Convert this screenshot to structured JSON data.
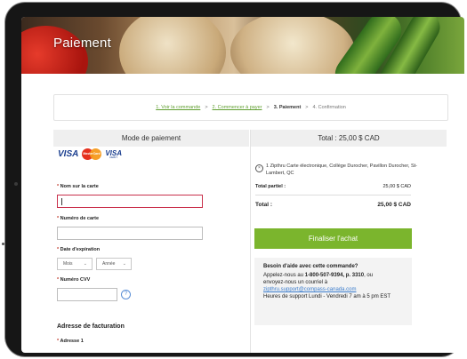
{
  "header": {
    "title": "Paiement"
  },
  "breadcrumb": {
    "step1": "1. Voir la commande",
    "step2": "2. Commencer à payer",
    "step3": "3. Paiement",
    "step4": "4. Confirmation",
    "sep": ">"
  },
  "payment": {
    "heading": "Mode de paiement",
    "cards": {
      "visa": "VISA",
      "mastercard": "MasterCard",
      "visa_debit_top": "VISA",
      "visa_debit_bottom": "DEBIT"
    },
    "name_label": "Nom sur la carte",
    "card_number_label": "Numéro de carte",
    "expiry_label": "Date d'expiration",
    "month_select": "Mois",
    "year_select": "Année",
    "cvv_label": "Numéro CVV",
    "help_symbol": "?",
    "required_mark": "*",
    "billing_title": "Adresse de facturation",
    "address_label": "Adresse 1"
  },
  "summary": {
    "heading": "Total : 25,00 $ CAD",
    "item_text": "1 Zipthru Carte électronique, Collège Durocher, Pavillon Durocher, St-Lambert, QC",
    "subtotal_label": "Total partiel :",
    "subtotal_value": "25,00 $ CAD",
    "total_label": "Total :",
    "total_value": "25,00 $ CAD",
    "finalize_button": "Finaliser l'achat"
  },
  "help": {
    "title": "Besoin d'aide avec cette commande?",
    "line1": "Appelez-nous au ",
    "phone": "1-800-507-9394, p. 3310",
    "line1_end": ", ou",
    "line2": "envoyez-nous un courriel à",
    "email": "zipthru.support@compass-canada.com",
    "hours": "Heures de support Lundi - Vendredi 7 am à 5 pm EST"
  },
  "colors": {
    "accent": "#7bb52d",
    "link": "#5f9e2f",
    "required": "#c0392b"
  }
}
